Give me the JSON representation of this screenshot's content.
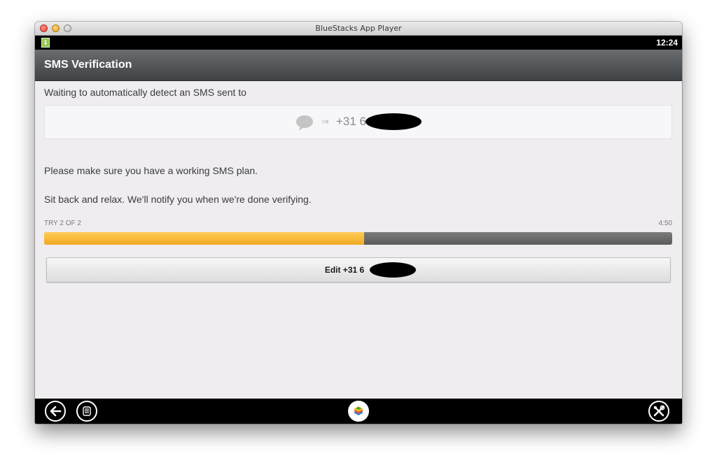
{
  "window": {
    "title": "BlueStacks App Player"
  },
  "status_bar": {
    "time": "12:24",
    "notification_icon": "download-notification-icon"
  },
  "action_bar": {
    "title": "SMS Verification"
  },
  "content": {
    "waiting_text": "Waiting to automatically detect an SMS sent to",
    "phone_prefix": "+31 6",
    "plan_text": "Please make sure you have a working SMS plan.",
    "relax_text": "Sit back and relax. We'll notify you when we're done verifying.",
    "try_label": "TRY 2 OF 2",
    "time_remaining": "4:50",
    "progress_fraction": 0.51,
    "edit_button_label": "Edit +31 6"
  },
  "colors": {
    "progress_fill": "#f2a921",
    "progress_track": "#6b6b6b",
    "action_bar": "#4f5254"
  },
  "nav_bar": {
    "icons": [
      "back-icon",
      "menu-icon",
      "bluestacks-home-icon",
      "settings-tools-icon"
    ]
  }
}
